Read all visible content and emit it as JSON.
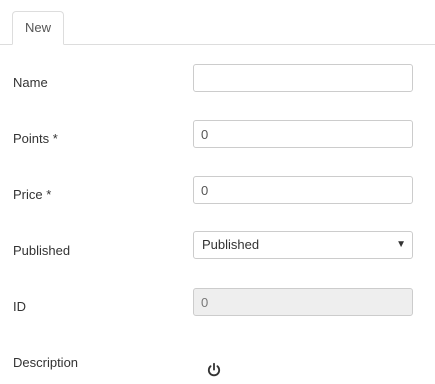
{
  "tabs": [
    {
      "label": "New",
      "active": true
    }
  ],
  "form": {
    "name": {
      "label": "Name",
      "value": "",
      "placeholder": ""
    },
    "points": {
      "label": "Points *",
      "value": "0"
    },
    "price": {
      "label": "Price *",
      "value": "0"
    },
    "published": {
      "label": "Published",
      "selected": "Published"
    },
    "id": {
      "label": "ID",
      "value": "0"
    },
    "description": {
      "label": "Description",
      "icon": "power-icon"
    }
  },
  "colors": {
    "border": "#cccccc",
    "readonly_bg": "#eeeeee",
    "tab_border": "#dddddd",
    "text": "#333333"
  }
}
